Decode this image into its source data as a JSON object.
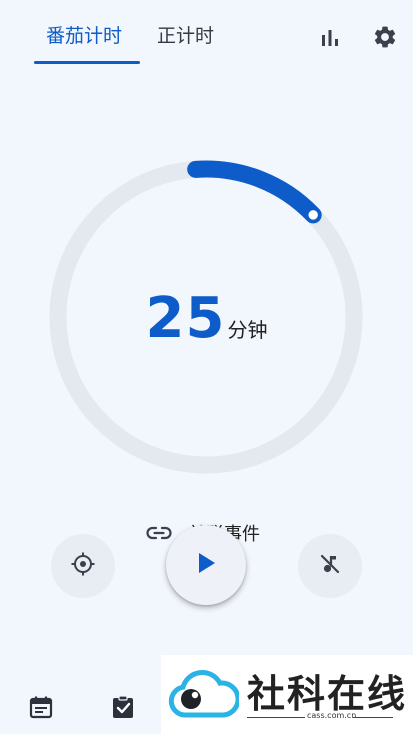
{
  "header": {
    "tabs": [
      {
        "label": "番茄计时",
        "active": true
      },
      {
        "label": "正计时",
        "active": false
      }
    ],
    "icons": [
      "bar-chart-icon",
      "settings-gear-icon"
    ]
  },
  "timer": {
    "value": "25",
    "unit": "分钟",
    "progress_fraction": 0.14,
    "accent_color": "#0d5cc9",
    "track_color": "#e4e8ef"
  },
  "linked_event": {
    "label": "关联事件",
    "icon": "link-icon"
  },
  "controls": {
    "focus_icon": "gps-target-icon",
    "play_icon": "play-icon",
    "mute_icon": "music-off-icon"
  },
  "bottom_nav": {
    "items": [
      {
        "icon": "calendar-icon"
      },
      {
        "icon": "task-check-icon"
      }
    ]
  },
  "watermark": {
    "title": "社科在线",
    "url": "cass.com.cn"
  }
}
